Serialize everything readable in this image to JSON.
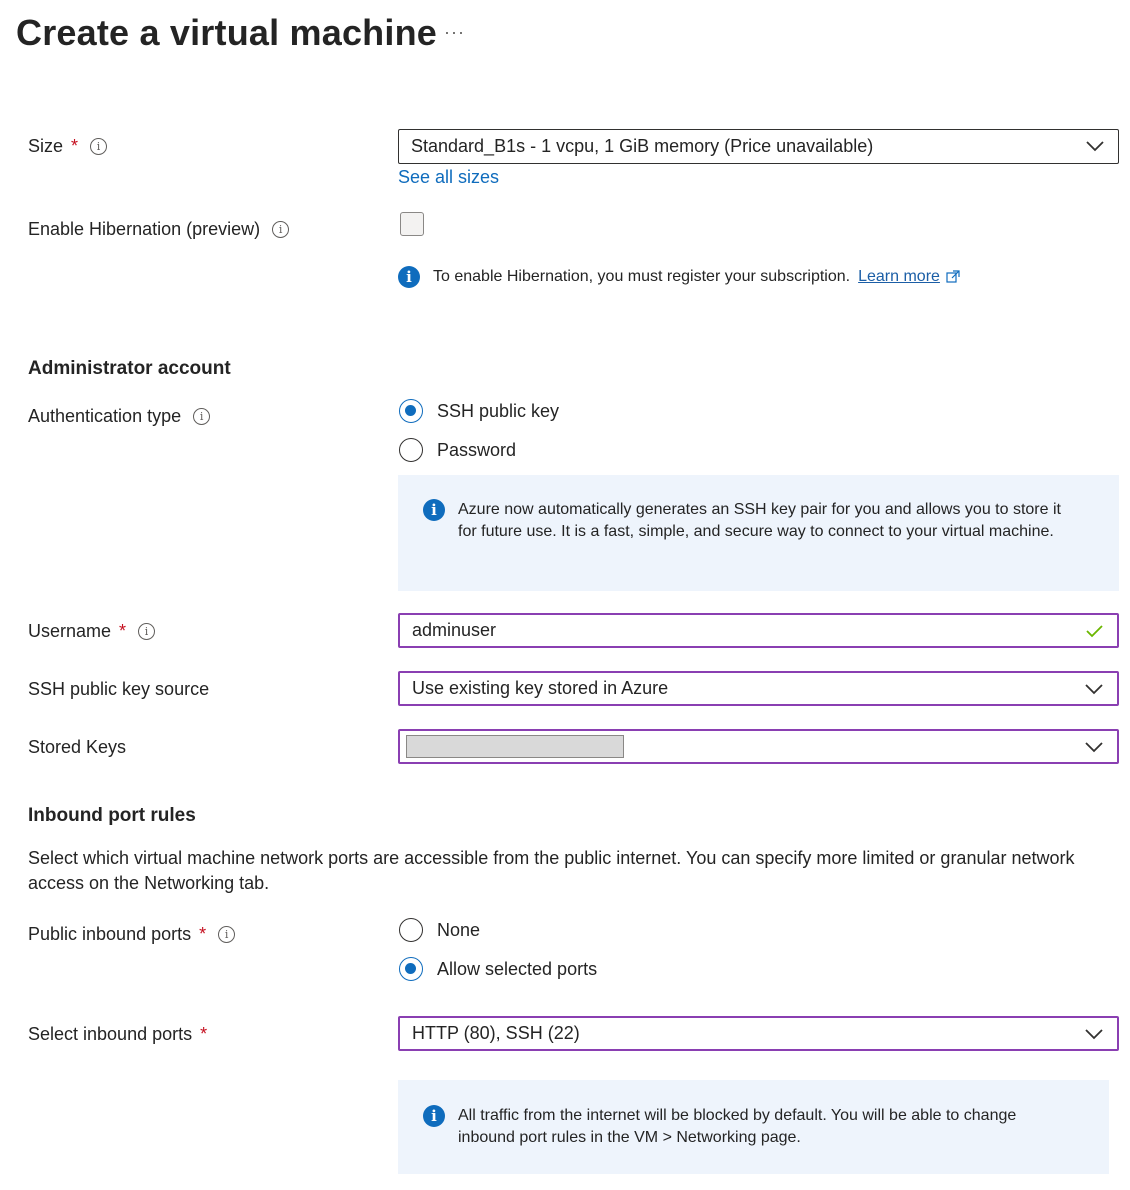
{
  "page": {
    "title": "Create a virtual machine",
    "more_label": "···"
  },
  "size": {
    "label": "Size",
    "required": "*",
    "value": "Standard_B1s - 1 vcpu, 1 GiB memory (Price unavailable)",
    "see_all_link": "See all sizes"
  },
  "hibernation": {
    "label": "Enable Hibernation (preview)",
    "checked": false,
    "notice": "To enable Hibernation, you must register your subscription.",
    "learn_more": "Learn more"
  },
  "admin_section": {
    "heading": "Administrator account",
    "auth_type": {
      "label": "Authentication type",
      "options": [
        {
          "label": "SSH public key",
          "selected": true
        },
        {
          "label": "Password",
          "selected": false
        }
      ]
    },
    "ssh_notice": "Azure now automatically generates an SSH key pair for you and allows you to store it for future use. It is a fast, simple, and secure way to connect to your virtual machine.",
    "username": {
      "label": "Username",
      "required": "*",
      "value": "adminuser"
    },
    "key_source": {
      "label": "SSH public key source",
      "value": "Use existing key stored in Azure"
    },
    "stored_keys": {
      "label": "Stored Keys",
      "value": ""
    }
  },
  "inbound_section": {
    "heading": "Inbound port rules",
    "description": "Select which virtual machine network ports are accessible from the public internet. You can specify more limited or granular network access on the Networking tab.",
    "public_ports": {
      "label": "Public inbound ports",
      "required": "*",
      "options": [
        {
          "label": "None",
          "selected": false
        },
        {
          "label": "Allow selected ports",
          "selected": true
        }
      ]
    },
    "select_ports": {
      "label": "Select inbound ports",
      "required": "*",
      "value": "HTTP (80), SSH (22)"
    },
    "traffic_notice": "All traffic from the internet will be blocked by default. You will be able to change inbound port rules in the VM > Networking page."
  },
  "colors": {
    "accent": "#0f6cbd",
    "focus_border": "#8a3fb2",
    "required": "#c50f1f",
    "valid": "#6bb700",
    "info_bg": "#eef4fc"
  }
}
